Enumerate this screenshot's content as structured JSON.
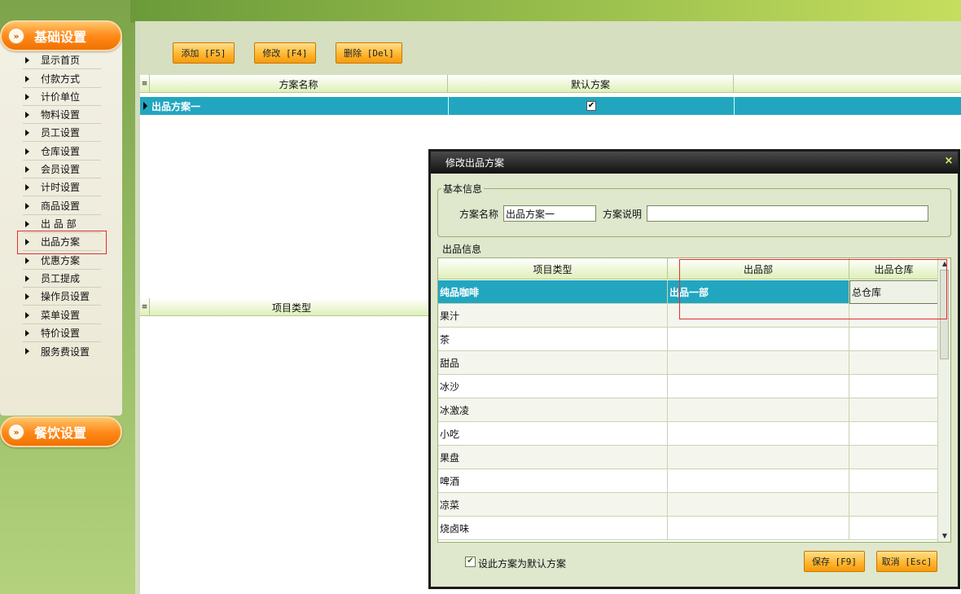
{
  "sidebar": {
    "section1": "基础设置",
    "section2": "餐饮设置",
    "items": [
      "显示首页",
      "付款方式",
      "计价单位",
      "物料设置",
      "员工设置",
      "仓库设置",
      "会员设置",
      "计时设置",
      "商品设置",
      "出 品 部",
      "出品方案",
      "优惠方案",
      "员工提成",
      "操作员设置",
      "菜单设置",
      "特价设置",
      "服务费设置"
    ],
    "active_item": "出品方案"
  },
  "toolbar": {
    "add": "添加 [F5]",
    "edit": "修改 [F4]",
    "delete": "删除 [Del]"
  },
  "plan_grid": {
    "columns": [
      "方案名称",
      "默认方案"
    ],
    "rows": [
      {
        "name": "出品方案一",
        "default": true
      }
    ]
  },
  "detail_grid": {
    "columns": [
      "项目类型"
    ]
  },
  "dialog": {
    "title": "修改出品方案",
    "close": "×",
    "basic_legend": "基本信息",
    "name_label": "方案名称",
    "name_value": "出品方案一",
    "desc_label": "方案说明",
    "desc_value": "",
    "output_legend": "出品信息",
    "columns": [
      "项目类型",
      "出品部",
      "出品仓库"
    ],
    "rows": [
      {
        "type": "纯品咖啡",
        "dept": "出品一部",
        "store": "总仓库"
      },
      {
        "type": "果汁",
        "dept": "",
        "store": ""
      },
      {
        "type": "茶",
        "dept": "",
        "store": ""
      },
      {
        "type": "甜品",
        "dept": "",
        "store": ""
      },
      {
        "type": "冰沙",
        "dept": "",
        "store": ""
      },
      {
        "type": "冰激凌",
        "dept": "",
        "store": ""
      },
      {
        "type": "小吃",
        "dept": "",
        "store": ""
      },
      {
        "type": "果盘",
        "dept": "",
        "store": ""
      },
      {
        "type": "啤酒",
        "dept": "",
        "store": ""
      },
      {
        "type": "凉菜",
        "dept": "",
        "store": ""
      },
      {
        "type": "烧卤味",
        "dept": "",
        "store": ""
      }
    ],
    "default_checkbox_label": "设此方案为默认方案",
    "default_checked": true,
    "save": "保存 [F9]",
    "cancel": "取消 [Esc]"
  },
  "colors": {
    "selection": "#22a6c0",
    "accent_orange": "#ff9a1a",
    "highlight_red": "#e03030"
  }
}
